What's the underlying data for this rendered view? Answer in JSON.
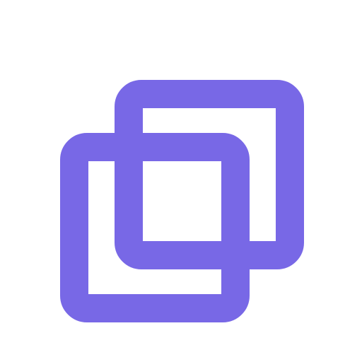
{
  "icon": {
    "name": "copy-icon",
    "color": "#7868E6",
    "background": "#FFFFFF"
  }
}
